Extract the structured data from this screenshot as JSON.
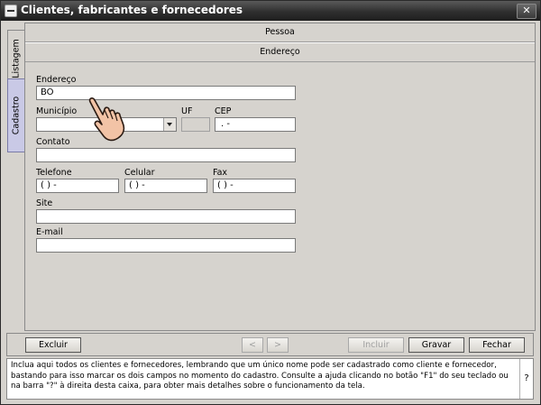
{
  "window": {
    "title": "Clientes, fabricantes e fornecedores",
    "close_glyph": "✕"
  },
  "tabs": [
    {
      "label": "Listagem"
    },
    {
      "label": "Cadastro"
    }
  ],
  "sections": {
    "pessoa": "Pessoa",
    "endereco": "Endereço"
  },
  "form": {
    "endereco": {
      "label": "Endereço",
      "value": "BO"
    },
    "municipio": {
      "label": "Município",
      "value": ""
    },
    "uf": {
      "label": "UF",
      "value": ""
    },
    "cep": {
      "label": "CEP",
      "value": ".   -"
    },
    "contato": {
      "label": "Contato",
      "value": ""
    },
    "telefone": {
      "label": "Telefone",
      "value": "(   )      -"
    },
    "celular": {
      "label": "Celular",
      "value": "(   )      -"
    },
    "fax": {
      "label": "Fax",
      "value": "(   )      -"
    },
    "site": {
      "label": "Site",
      "value": ""
    },
    "email": {
      "label": "E-mail",
      "value": ""
    }
  },
  "buttons": {
    "excluir": "Excluir",
    "prev": "<",
    "next": ">",
    "incluir": "Incluir",
    "gravar": "Gravar",
    "fechar": "Fechar"
  },
  "help": {
    "text": "Inclua aqui todos os clientes e fornecedores, lembrando que um único nome pode ser cadastrado como cliente e fornecedor, bastando para isso marcar os dois campos no momento do cadastro. Consulte a ajuda clicando no botão \"F1\" do seu teclado ou na barra \"?\" à direita desta caixa, para obter mais detalhes sobre o funcionamento da tela.",
    "question_mark": "?"
  },
  "icons": {
    "cursor": "hand-pointer-icon",
    "system_menu": "window-menu-icon",
    "close": "close-icon",
    "dropdown": "chevron-down-icon"
  }
}
